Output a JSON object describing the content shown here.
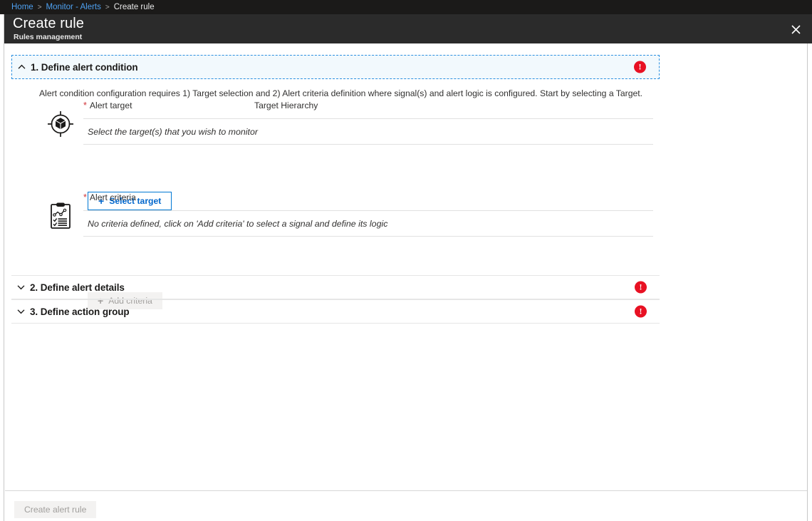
{
  "breadcrumb": {
    "items": [
      {
        "label": "Home",
        "current": false
      },
      {
        "label": "Monitor - Alerts",
        "current": false
      },
      {
        "label": "Create rule",
        "current": true
      }
    ],
    "separator": ">"
  },
  "header": {
    "title": "Create rule",
    "subtitle": "Rules management",
    "close_icon": "close-icon",
    "background": "#2b2b2b"
  },
  "colors": {
    "accent_blue": "#0078d4",
    "link_blue": "#4ea0f0",
    "error_red": "#e81123",
    "required_red": "#d13438",
    "focus_border": "#2a8fe0",
    "focus_fill": "#f2f9fd",
    "disabled_fill": "#f3f2f1",
    "disabled_text": "#a19f9d"
  },
  "sections": [
    {
      "id": "define-alert-condition",
      "title": "1. Define alert condition",
      "state": "expanded",
      "chevron": "chevron-up-icon",
      "has_error": true,
      "error_glyph": "!",
      "description": "Alert condition configuration requires 1) Target selection and 2) Alert criteria definition where signal(s) and alert logic is configured. Start by selecting a Target.",
      "fields": [
        {
          "id": "alert-target",
          "icon": "target-resource-icon",
          "required": true,
          "required_marker": "*",
          "label": "Alert target",
          "column2_label": "Target Hierarchy",
          "empty_text": "Select the target(s) that you wish to monitor",
          "button": {
            "label": "Select target",
            "icon": "plus-icon",
            "disabled": false
          }
        },
        {
          "id": "alert-criteria",
          "icon": "criteria-clipboard-icon",
          "required": true,
          "required_marker": "*",
          "label": "Alert criteria",
          "column2_label": "",
          "empty_text": "No criteria defined, click on 'Add criteria' to select a signal and define its logic",
          "button": {
            "label": "Add criteria",
            "icon": "plus-icon",
            "disabled": true
          }
        }
      ]
    },
    {
      "id": "define-alert-details",
      "title": "2. Define alert details",
      "state": "collapsed",
      "chevron": "chevron-down-icon",
      "has_error": true,
      "error_glyph": "!"
    },
    {
      "id": "define-action-group",
      "title": "3. Define action group",
      "state": "collapsed",
      "chevron": "chevron-down-icon",
      "has_error": true,
      "error_glyph": "!"
    }
  ],
  "footer": {
    "create_button": {
      "label": "Create alert rule",
      "disabled": true
    }
  }
}
